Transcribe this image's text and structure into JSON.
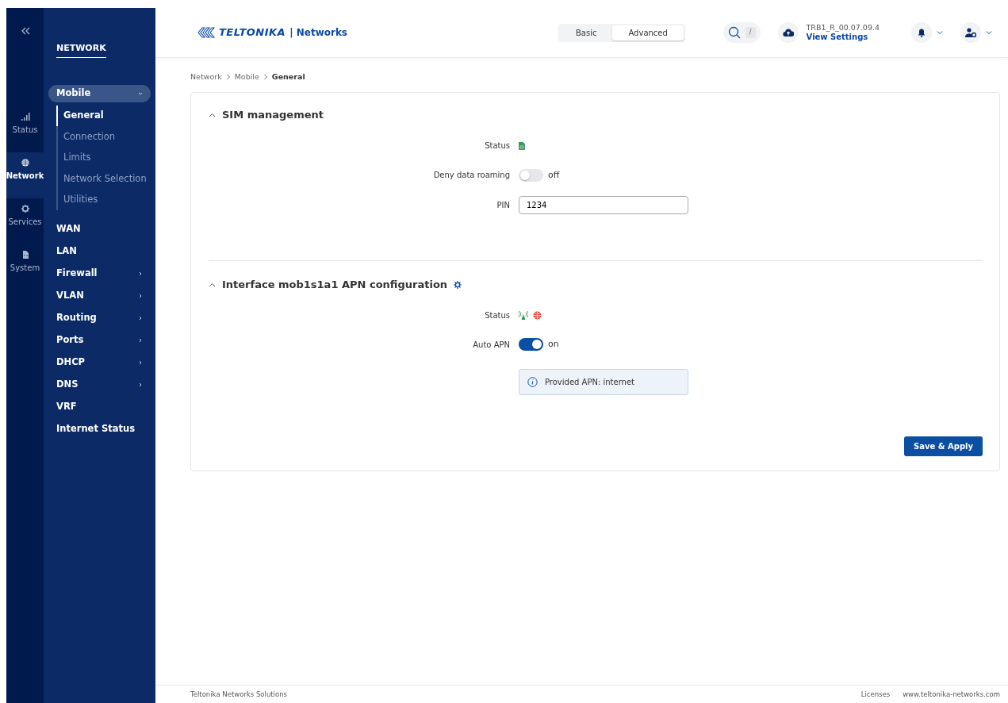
{
  "rail": {
    "items": [
      {
        "label": "Status",
        "selected": false
      },
      {
        "label": "Network",
        "selected": true
      },
      {
        "label": "Services",
        "selected": false
      },
      {
        "label": "System",
        "selected": false
      }
    ]
  },
  "nav": {
    "title": "NETWORK",
    "items": [
      {
        "label": "Mobile",
        "submenu": true,
        "expanded": true,
        "children": [
          {
            "label": "General",
            "selected": true
          },
          {
            "label": "Connection",
            "selected": false
          },
          {
            "label": "Limits",
            "selected": false
          },
          {
            "label": "Network Selection",
            "selected": false
          },
          {
            "label": "Utilities",
            "selected": false
          }
        ]
      },
      {
        "label": "WAN",
        "submenu": false,
        "expanded": false
      },
      {
        "label": "LAN",
        "submenu": false,
        "expanded": false
      },
      {
        "label": "Firewall",
        "submenu": true,
        "expanded": false
      },
      {
        "label": "VLAN",
        "submenu": true,
        "expanded": false
      },
      {
        "label": "Routing",
        "submenu": true,
        "expanded": false
      },
      {
        "label": "Ports",
        "submenu": true,
        "expanded": false
      },
      {
        "label": "DHCP",
        "submenu": true,
        "expanded": false
      },
      {
        "label": "DNS",
        "submenu": true,
        "expanded": false
      },
      {
        "label": "VRF",
        "submenu": false,
        "expanded": false
      },
      {
        "label": "Internet Status",
        "submenu": false,
        "expanded": false
      }
    ]
  },
  "header": {
    "brand": "TELTONIKA",
    "brand_suffix": "| Networks",
    "modes": [
      {
        "label": "Basic",
        "selected": false
      },
      {
        "label": "Advanced",
        "selected": true
      }
    ],
    "search_shortcut": "/",
    "firmware": "TRB1_R_00.07.09.4",
    "settings_link": "View Settings"
  },
  "breadcrumb": [
    "Network",
    "Mobile",
    "General"
  ],
  "sections": [
    {
      "title": "SIM management",
      "expanded": true,
      "settings": false,
      "fields": [
        {
          "kind": "sim_status",
          "label": "Status"
        },
        {
          "kind": "toggle",
          "label": "Deny data roaming",
          "on": false,
          "text": "off"
        },
        {
          "kind": "input",
          "label": "PIN",
          "value": "1234"
        }
      ]
    },
    {
      "title": "Interface mob1s1a1 APN configuration",
      "expanded": true,
      "settings": true,
      "fields": [
        {
          "kind": "link_status",
          "label": "Status"
        },
        {
          "kind": "toggle",
          "label": "Auto APN",
          "on": true,
          "text": "on"
        },
        {
          "kind": "info",
          "text": "Provided APN: internet"
        }
      ]
    }
  ],
  "save_button": "Save & Apply",
  "footer": {
    "company": "Teltonika Networks Solutions",
    "links": [
      "Licenses",
      "www.teltonika-networks.com"
    ]
  }
}
